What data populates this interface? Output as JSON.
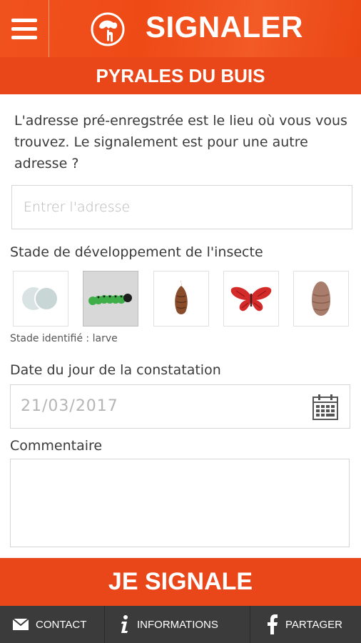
{
  "header": {
    "title": "SIGNALER",
    "menu_icon": "hamburger-menu-icon",
    "logo_icon": "report-hand-icon",
    "subtitle": "PYRALES DU BUIS"
  },
  "intro_text": "L'adresse pré-enregstrée est le lieu où vous vous trouvez. Le signalement est pour une autre adresse ?",
  "address": {
    "placeholder": "Entrer l'adresse",
    "value": ""
  },
  "stage": {
    "label": "Stade de développement de l'insecte",
    "options": [
      {
        "name": "eggs",
        "icon": "eggs-icon",
        "selected": false
      },
      {
        "name": "larve",
        "icon": "caterpillar-icon",
        "selected": true
      },
      {
        "name": "chrysalide",
        "icon": "chrysalis-icon",
        "selected": false
      },
      {
        "name": "papillon",
        "icon": "butterfly-icon",
        "selected": false
      },
      {
        "name": "cocon",
        "icon": "cocoon-icon",
        "selected": false
      }
    ],
    "status": "Stade identifié : larve"
  },
  "date": {
    "label": "Date du jour de la constatation",
    "value": "21/03/2017",
    "icon": "calendar-icon"
  },
  "comment": {
    "label": "Commentaire",
    "value": ""
  },
  "submit_label": "JE SIGNALE",
  "footer": {
    "items": [
      {
        "label": "CONTACT",
        "icon": "envelope-icon"
      },
      {
        "label": "INFORMATIONS",
        "icon": "info-icon"
      },
      {
        "label": "PARTAGER",
        "icon": "facebook-icon"
      }
    ]
  },
  "colors": {
    "brand": "#ee4a16",
    "subheader": "#e9461a",
    "footer": "#3b3b3b"
  }
}
